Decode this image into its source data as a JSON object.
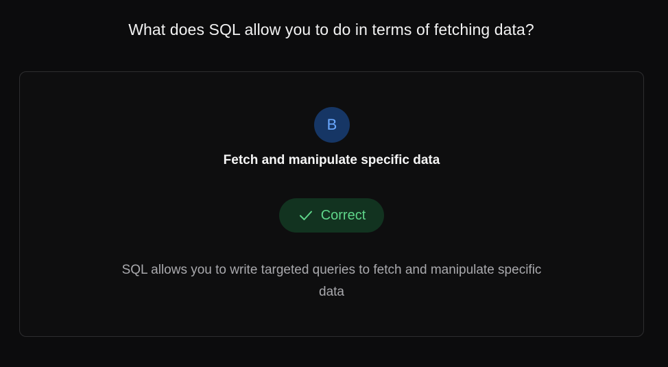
{
  "question": {
    "text": "What does SQL allow you to do in terms of fetching data?"
  },
  "answer": {
    "letter": "B",
    "text": "Fetch and manipulate specific data",
    "result_label": "Correct",
    "result_icon": "check-icon",
    "explanation": "SQL allows you to write targeted queries to fetch and manipulate specific data"
  },
  "colors": {
    "background": "#0c0c0d",
    "card_border": "#2e2e30",
    "letter_bg": "#163665",
    "letter_fg": "#6aa8ff",
    "correct_bg": "#123320",
    "correct_fg": "#5fd68a",
    "explanation_fg": "#a9a9ad"
  }
}
